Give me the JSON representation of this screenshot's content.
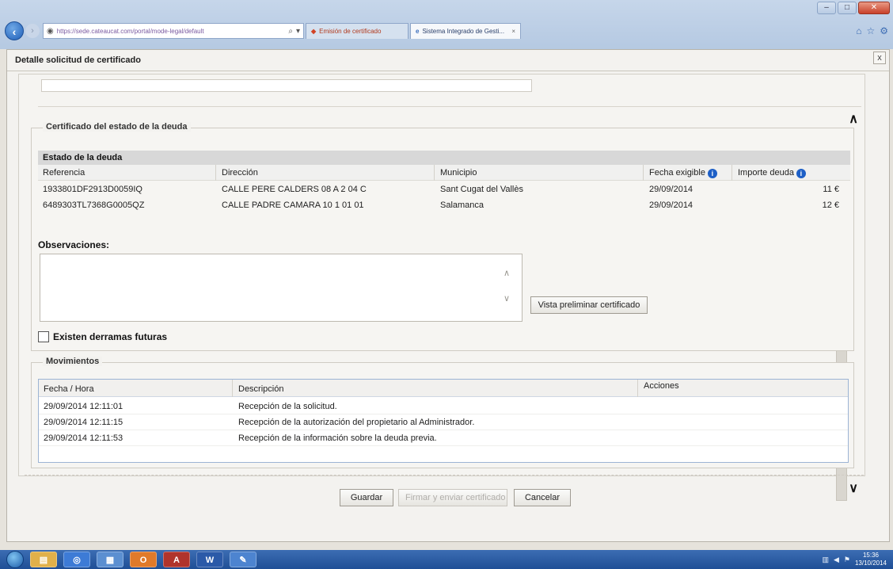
{
  "browser": {
    "address_url": "https://sede.cateaucat.com/portal/mode-legal/default",
    "tabs": [
      {
        "label": "Emisión de certificado",
        "icon": "warning-icon"
      },
      {
        "label": "Sistema Integrado de Gesti...",
        "icon": "ie-page-icon"
      }
    ]
  },
  "dialog": {
    "title": "Detalle solicitud de certificado",
    "close_glyph": "x"
  },
  "debt_section": {
    "legend": "Certificado del estado de la deuda",
    "header": "Estado de la deuda",
    "columns": {
      "referencia": "Referencia",
      "direccion": "Dirección",
      "municipio": "Municipio",
      "fecha": "Fecha exigible",
      "importe": "Importe deuda"
    },
    "rows": [
      {
        "referencia": "1933801DF2913D0059IQ",
        "direccion": "CALLE PERE CALDERS 08 A 2 04 C",
        "municipio": "Sant Cugat del Vallès",
        "fecha": "29/09/2014",
        "importe": "11 €"
      },
      {
        "referencia": "6489303TL7368G0005QZ",
        "direccion": "CALLE PADRE CAMARA 10 1 01 01",
        "municipio": "Salamanca",
        "fecha": "29/09/2014",
        "importe": "12 €"
      }
    ],
    "observaciones_label": "Observaciones:",
    "observaciones_value": "",
    "preview_button": "Vista preliminar certificado",
    "derramas_label": "Existen derramas futuras",
    "derramas_checked": false
  },
  "movimientos": {
    "legend": "Movimientos",
    "columns": {
      "fecha": "Fecha / Hora",
      "descripcion": "Descripción",
      "acciones": "Acciones"
    },
    "rows": [
      {
        "fecha": "29/09/2014 12:11:01",
        "descripcion": "Recepción de la solicitud."
      },
      {
        "fecha": "29/09/2014 12:11:15",
        "descripcion": "Recepción de la autorización del propietario al Administrador."
      },
      {
        "fecha": "29/09/2014 12:11:53",
        "descripcion": "Recepción de la información sobre la deuda previa."
      }
    ]
  },
  "actions": {
    "guardar": "Guardar",
    "firmar": "Firmar y enviar certificado",
    "cancelar": "Cancelar"
  },
  "taskbar": {
    "apps": [
      "folder-icon",
      "chrome-icon",
      "app-icon",
      "outlook-icon",
      "access-icon",
      "word-icon",
      "notes-icon"
    ],
    "clock_time": "15:36",
    "clock_date": "13/10/2014"
  },
  "colors": {
    "info_blue": "#1d5fc6",
    "taskbar": "#2a5aa0",
    "header_gray": "#d8d8d8"
  }
}
